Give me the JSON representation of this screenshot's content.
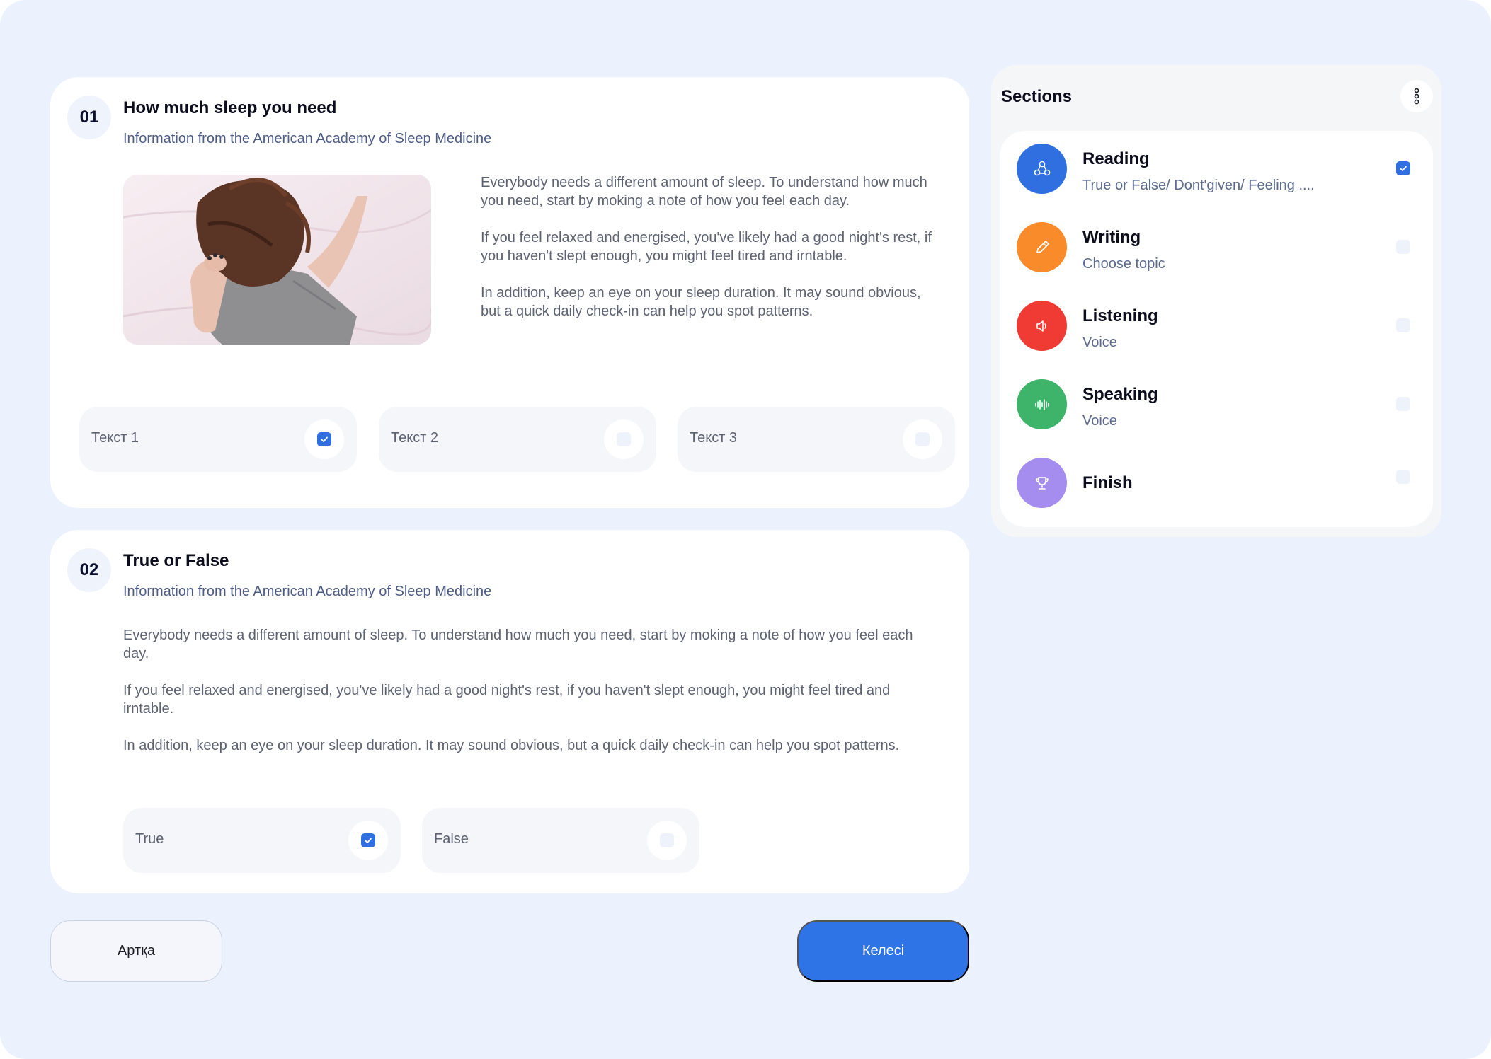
{
  "questions": [
    {
      "number": "01",
      "title": "How much sleep you need",
      "subtitle": "Information from the American Academy of Sleep Medicine",
      "paragraphs": [
        "Everybody needs a different amount of sleep. To understand how much you need, start by moking a note of how you feel each day.",
        "If you feel relaxed and energised, you've likely had a good night's rest, if you haven't slept enough, you might feel tired and irntable.",
        "In addition, keep an eye on your sleep duration. It may sound obvious, but a quick daily check-in can help you spot patterns."
      ],
      "options": [
        {
          "label": "Текст 1",
          "checked": true
        },
        {
          "label": "Текст 2",
          "checked": false
        },
        {
          "label": "Текст 3",
          "checked": false
        }
      ]
    },
    {
      "number": "02",
      "title": "True or False",
      "subtitle": "Information from the American Academy of Sleep Medicine",
      "paragraphs": [
        "Everybody needs a different amount of sleep. To understand how much you need, start by moking a note of how you feel each day.",
        "If you feel relaxed and energised, you've likely had a good night's rest, if you haven't slept enough, you might feel tired and irntable.",
        "In addition, keep an eye on your sleep duration. It may sound obvious, but a quick daily check-in can help you spot patterns."
      ],
      "options": [
        {
          "label": "True",
          "checked": true
        },
        {
          "label": "False",
          "checked": false
        }
      ]
    }
  ],
  "buttons": {
    "back": "Артқа",
    "next": "Келесі"
  },
  "sections": {
    "title": "Sections",
    "more_icon": "more-vertical-icon",
    "items": [
      {
        "name": "Reading",
        "description": "True or False/ Dont'given/ Feeling ....",
        "icon": "reading-icon",
        "color": "#2f6fe0",
        "checked": true
      },
      {
        "name": "Writing",
        "description": "Choose topic",
        "icon": "pen-icon",
        "color": "#f98b2a",
        "checked": false
      },
      {
        "name": "Listening",
        "description": "Voice",
        "icon": "speaker-icon",
        "color": "#ef3b33",
        "checked": false
      },
      {
        "name": "Speaking",
        "description": "Voice",
        "icon": "waveform-icon",
        "color": "#3db46a",
        "checked": false
      },
      {
        "name": "Finish",
        "description": "",
        "icon": "trophy-icon",
        "color": "#a58df0",
        "checked": false
      }
    ]
  },
  "colors": {
    "background": "#ecf2fd",
    "accent": "#2f74e6"
  }
}
